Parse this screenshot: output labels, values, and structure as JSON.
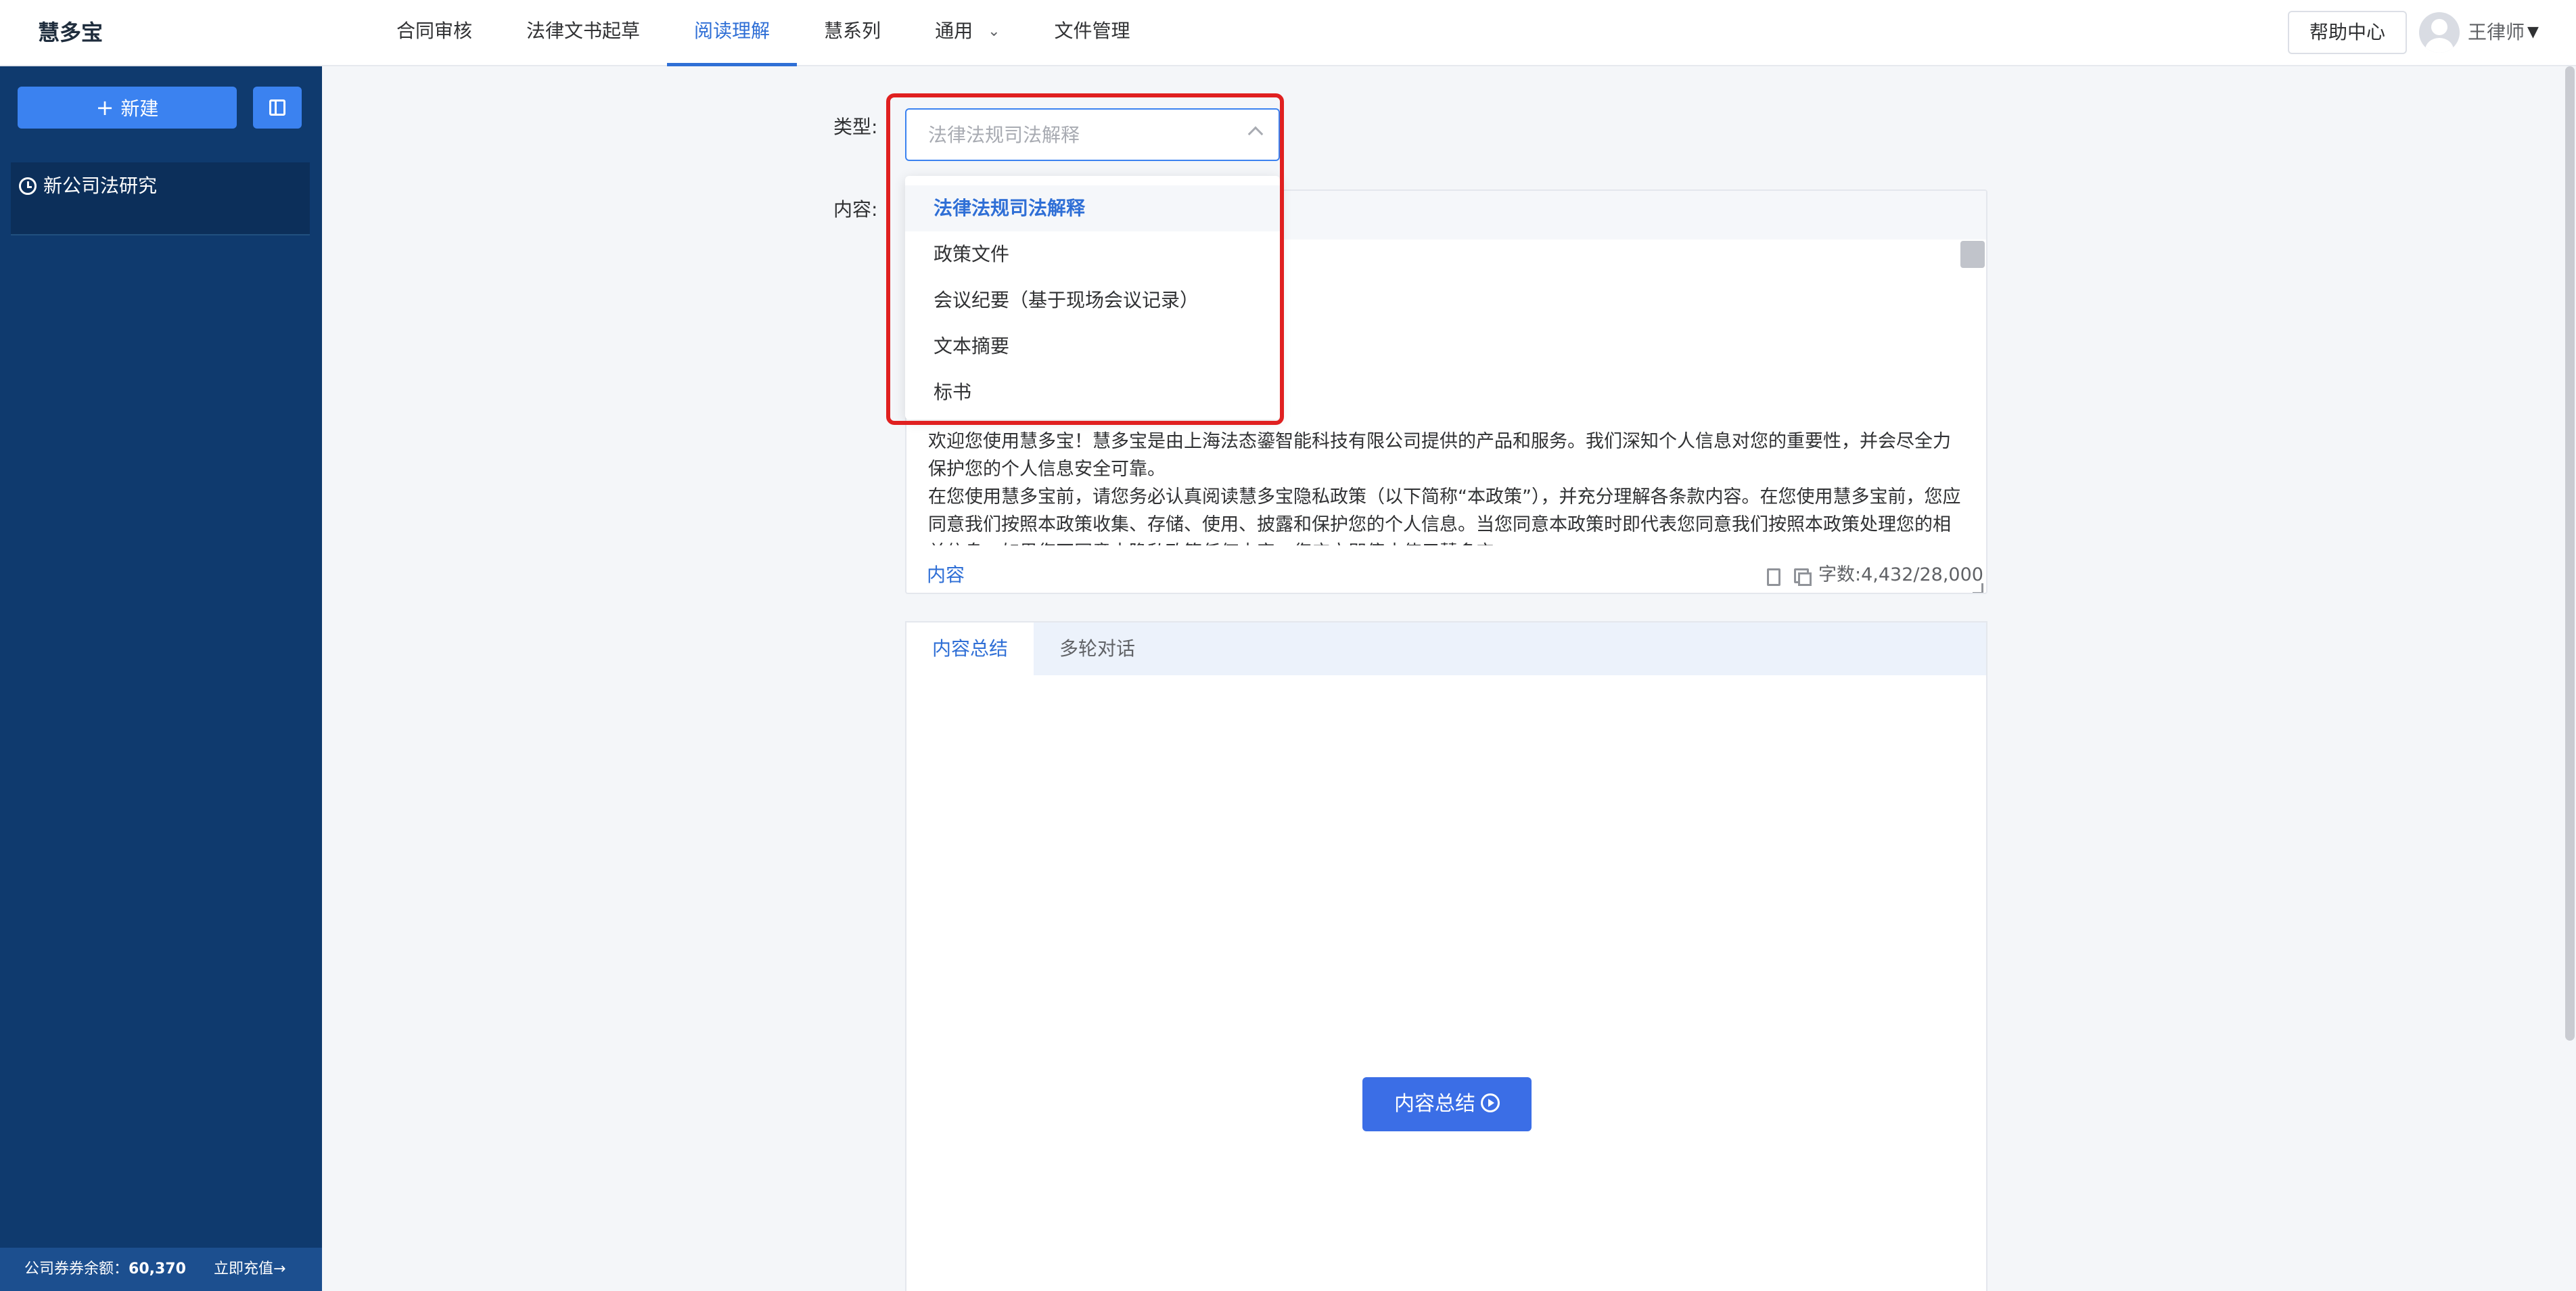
{
  "header": {
    "brand": "慧多宝",
    "nav": [
      {
        "label": "合同审核"
      },
      {
        "label": "法律文书起草"
      },
      {
        "label": "阅读理解"
      },
      {
        "label": "慧系列"
      },
      {
        "label": "通用"
      },
      {
        "label": "文件管理"
      }
    ],
    "active_nav": "阅读理解",
    "help_label": "帮助中心",
    "user_name": "王律师"
  },
  "sidebar": {
    "new_button_label": "新建",
    "history": [
      {
        "label": "新公司法研究"
      }
    ],
    "balance_label": "公司券券余额：",
    "balance_value": "60,370",
    "recharge_label": "立即充值→"
  },
  "form": {
    "type_label": "类型:",
    "content_label": "内容:",
    "select_placeholder": "法律法规司法解释",
    "dropdown_options": [
      {
        "label": "法律法规司法解释",
        "selected": true
      },
      {
        "label": "政策文件",
        "selected": false
      },
      {
        "label": "会议纪要（基于现场会议记录）",
        "selected": false
      },
      {
        "label": "文本摘要",
        "selected": false
      },
      {
        "label": "标书",
        "selected": false
      }
    ],
    "content_paragraphs": [
      "欢迎您使用慧多宝！慧多宝是由上海法态鎏智能科技有限公司提供的产品和服务。我们深知个人信息对您的重要性，并会尽全力保护您的个人信息安全可靠。",
      "在您使用慧多宝前，请您务必认真阅读慧多宝隐私政策（以下简称“本政策”），并充分理解各条款内容。在您使用慧多宝前，您应同意我们按照本政策收集、存储、使用、披露和保护您的个人信息。当您同意本政策时即代表您同意我们按照本政策处理您的相关信息。如果您不同意本隐私政策任何内容，您应立即停止使用慧多宝。"
    ],
    "content_tag": "内容",
    "word_count": "字数:4,432/28,000"
  },
  "result": {
    "tabs": [
      {
        "label": "内容总结"
      },
      {
        "label": "多轮对话"
      }
    ],
    "active_tab": "内容总结",
    "summary_button_label": "内容总结"
  },
  "colors": {
    "accent": "#2f6fd6",
    "sidebar_bg": "#0f3a6e",
    "highlight": "#e02020"
  }
}
